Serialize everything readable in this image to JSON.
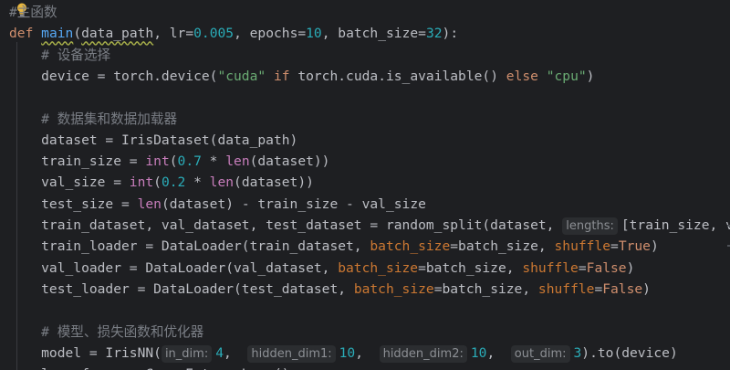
{
  "lines": [
    {
      "id": "l0",
      "tokens": [
        {
          "t": "#",
          "c": "cm"
        },
        {
          "t": "主函数",
          "c": "cm"
        }
      ]
    },
    {
      "id": "l1",
      "tokens": [
        {
          "t": "def ",
          "c": "kw"
        },
        {
          "t": "main",
          "c": "fn squig"
        },
        {
          "t": "(",
          "c": ""
        },
        {
          "t": "data_path",
          "c": "squig"
        },
        {
          "t": ", lr=",
          "c": ""
        },
        {
          "t": "0.005",
          "c": "num"
        },
        {
          "t": ", epochs=",
          "c": ""
        },
        {
          "t": "10",
          "c": "num"
        },
        {
          "t": ", batch_size=",
          "c": ""
        },
        {
          "t": "32",
          "c": "num"
        },
        {
          "t": "):",
          "c": ""
        }
      ]
    },
    {
      "id": "l2",
      "tokens": [
        {
          "t": "    # 设备选择",
          "c": "cm"
        }
      ]
    },
    {
      "id": "l3",
      "tokens": [
        {
          "t": "    device = torch.device(",
          "c": ""
        },
        {
          "t": "\"cuda\"",
          "c": "str"
        },
        {
          "t": " if ",
          "c": "kw"
        },
        {
          "t": "torch.cuda.is_available() ",
          "c": ""
        },
        {
          "t": "else ",
          "c": "kw"
        },
        {
          "t": "\"cpu\"",
          "c": "str"
        },
        {
          "t": ")",
          "c": ""
        }
      ]
    },
    {
      "id": "l4",
      "tokens": []
    },
    {
      "id": "l5",
      "tokens": [
        {
          "t": "    # 数据集和数据加载器",
          "c": "cm"
        }
      ]
    },
    {
      "id": "l6",
      "tokens": [
        {
          "t": "    dataset = IrisDataset(data_path)",
          "c": ""
        }
      ]
    },
    {
      "id": "l7",
      "tokens": [
        {
          "t": "    train_size = ",
          "c": ""
        },
        {
          "t": "int",
          "c": "param2"
        },
        {
          "t": "(",
          "c": ""
        },
        {
          "t": "0.7",
          "c": "num"
        },
        {
          "t": " * ",
          "c": ""
        },
        {
          "t": "len",
          "c": "param2"
        },
        {
          "t": "(dataset))",
          "c": ""
        }
      ]
    },
    {
      "id": "l8",
      "tokens": [
        {
          "t": "    val_size = ",
          "c": ""
        },
        {
          "t": "int",
          "c": "param2"
        },
        {
          "t": "(",
          "c": ""
        },
        {
          "t": "0.2",
          "c": "num"
        },
        {
          "t": " * ",
          "c": ""
        },
        {
          "t": "len",
          "c": "param2"
        },
        {
          "t": "(dataset))",
          "c": ""
        }
      ]
    },
    {
      "id": "l9",
      "tokens": [
        {
          "t": "    test_size = ",
          "c": ""
        },
        {
          "t": "len",
          "c": "param2"
        },
        {
          "t": "(dataset) - train_size - val_size",
          "c": ""
        }
      ]
    },
    {
      "id": "l10",
      "tokens": [
        {
          "t": "    train_dataset, val_dataset, test_dataset = random_split(dataset, ",
          "c": ""
        },
        {
          "t": "lengths:",
          "c": "hint"
        },
        {
          "t": "[train_size, val_s",
          "c": ""
        }
      ]
    },
    {
      "id": "l11",
      "tokens": [
        {
          "t": "    train_loader = DataLoader(train_dataset, ",
          "c": ""
        },
        {
          "t": "batch_size",
          "c": "param"
        },
        {
          "t": "=batch_size, ",
          "c": ""
        },
        {
          "t": "shuffle",
          "c": "param"
        },
        {
          "t": "=",
          "c": ""
        },
        {
          "t": "True",
          "c": "kw"
        },
        {
          "t": ")",
          "c": ""
        }
      ]
    },
    {
      "id": "l12",
      "tokens": [
        {
          "t": "    val_loader = DataLoader(val_dataset, ",
          "c": ""
        },
        {
          "t": "batch_size",
          "c": "param"
        },
        {
          "t": "=batch_size, ",
          "c": ""
        },
        {
          "t": "shuffle",
          "c": "param"
        },
        {
          "t": "=",
          "c": ""
        },
        {
          "t": "False",
          "c": "kw"
        },
        {
          "t": ")",
          "c": ""
        }
      ]
    },
    {
      "id": "l13",
      "tokens": [
        {
          "t": "    test_loader = DataLoader(test_dataset, ",
          "c": ""
        },
        {
          "t": "batch_size",
          "c": "param"
        },
        {
          "t": "=batch_size, ",
          "c": ""
        },
        {
          "t": "shuffle",
          "c": "param"
        },
        {
          "t": "=",
          "c": ""
        },
        {
          "t": "False",
          "c": "kw"
        },
        {
          "t": ")",
          "c": ""
        }
      ]
    },
    {
      "id": "l14",
      "tokens": []
    },
    {
      "id": "l15",
      "tokens": [
        {
          "t": "    # 模型、损失函数和优化器",
          "c": "cm"
        }
      ]
    },
    {
      "id": "l16",
      "tokens": [
        {
          "t": "    model = IrisNN(",
          "c": ""
        },
        {
          "t": "in_dim:",
          "c": "hint"
        },
        {
          "t": "4",
          "c": "num"
        },
        {
          "t": ",  ",
          "c": ""
        },
        {
          "t": "hidden_dim1:",
          "c": "hint"
        },
        {
          "t": "10",
          "c": "num"
        },
        {
          "t": ",  ",
          "c": ""
        },
        {
          "t": "hidden_dim2:",
          "c": "hint"
        },
        {
          "t": "10",
          "c": "num"
        },
        {
          "t": ",  ",
          "c": ""
        },
        {
          "t": "out_dim:",
          "c": "hint"
        },
        {
          "t": "3",
          "c": "num"
        },
        {
          "t": ").to(device)",
          "c": ""
        }
      ]
    },
    {
      "id": "l17",
      "tokens": [
        {
          "t": "    loss_fn = nn.CrossEntropyLoss()",
          "c": ""
        }
      ]
    }
  ],
  "theme": {
    "background": "#1e1f22",
    "keyword": "#cf8e6d",
    "function": "#56a8f5",
    "number": "#2aacb8",
    "string": "#6aab73",
    "comment": "#7a7e85",
    "named_param": "#cc7832"
  },
  "icons": {
    "intention": "lightbulb-icon"
  }
}
